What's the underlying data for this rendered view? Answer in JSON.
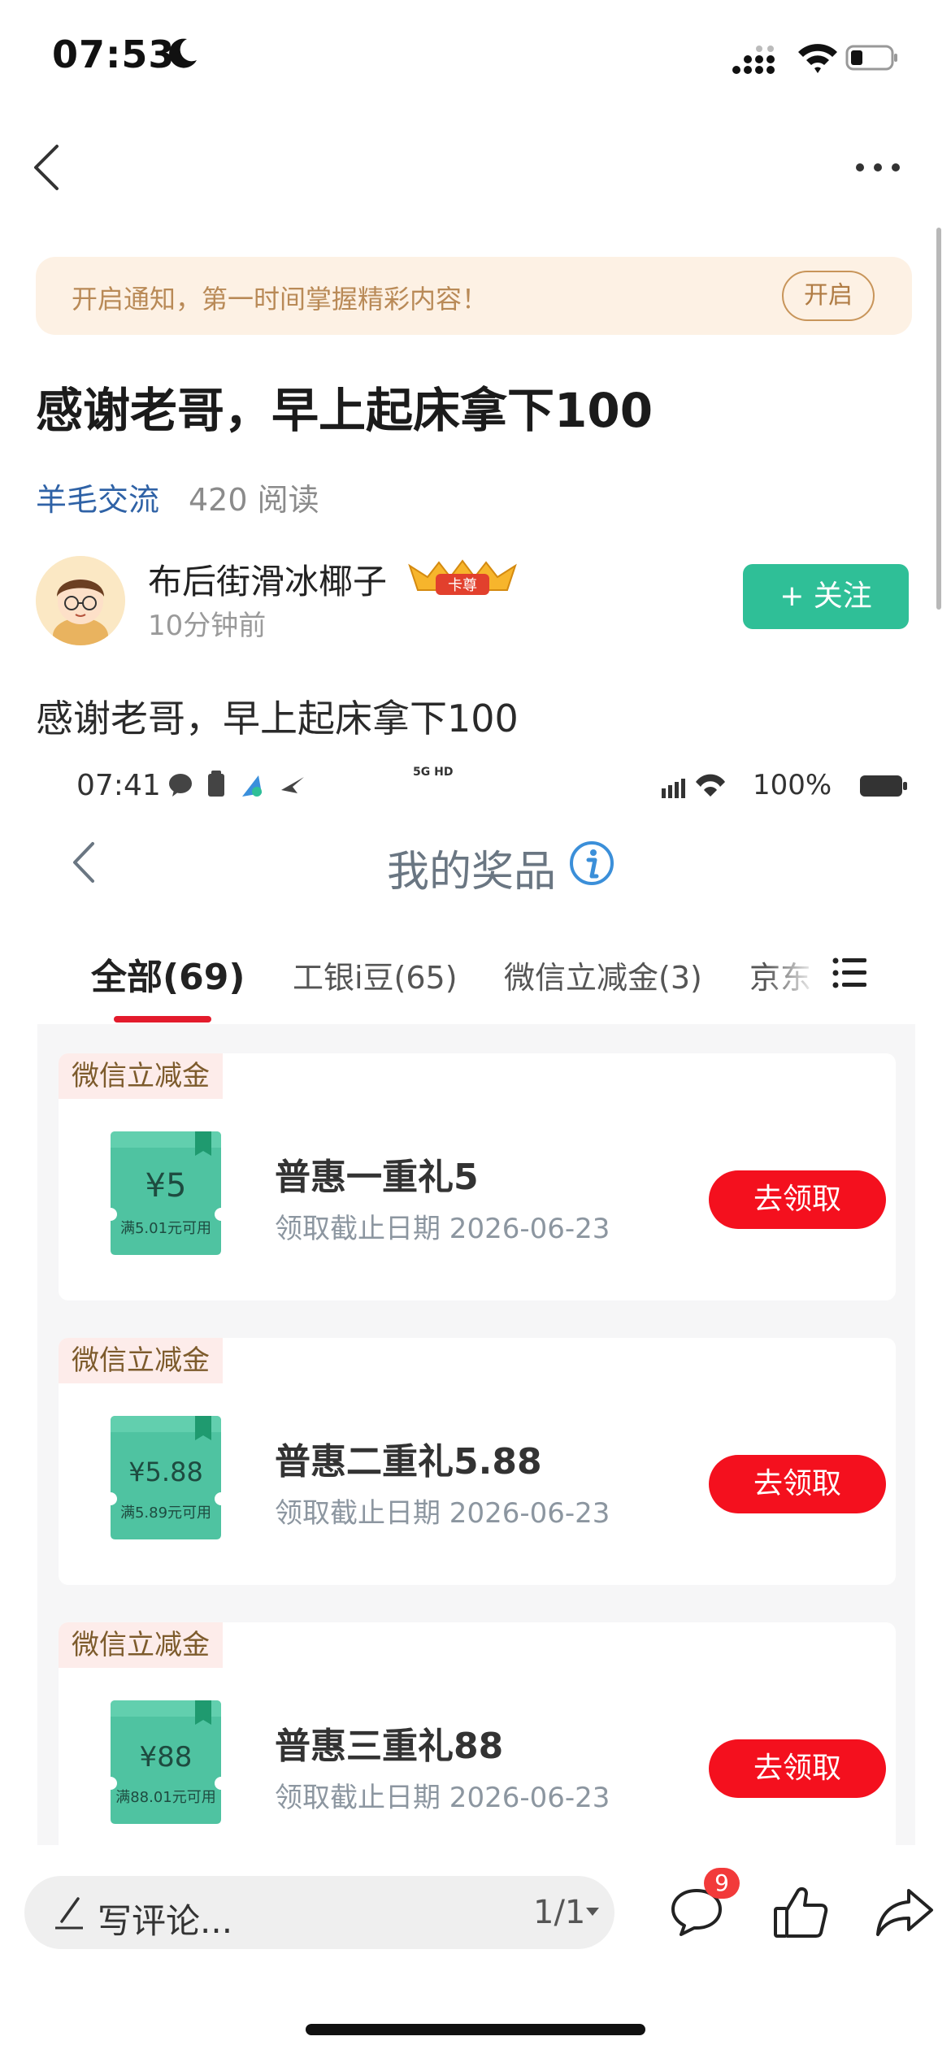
{
  "status_bar": {
    "time": "07:53"
  },
  "notify": {
    "text": "开启通知，第一时间掌握精彩内容！",
    "button": "开启"
  },
  "post": {
    "title": "感谢老哥，早上起床拿下100",
    "category": "羊毛交流",
    "reads": "420 阅读",
    "author": "布后街滑冰椰子",
    "vip_badge": "卡尊",
    "time_ago": "10分钟前",
    "follow_label": "+ 关注",
    "body": "感谢老哥，早上起床拿下100"
  },
  "screenshot": {
    "status_time": "07:41",
    "network": "5G HD",
    "battery": "100%",
    "title": "我的奖品",
    "tabs": [
      "全部(69)",
      "工银i豆(65)",
      "微信立减金(3)",
      "京东"
    ],
    "active_tab": 0,
    "cards": [
      {
        "tag": "微信立减金",
        "amount": "¥5",
        "condition": "满5.01元可用",
        "name": "普惠一重礼5",
        "date": "领取截止日期 2026-06-23",
        "button": "去领取"
      },
      {
        "tag": "微信立减金",
        "amount": "¥5.88",
        "condition": "满5.89元可用",
        "name": "普惠二重礼5.88",
        "date": "领取截止日期 2026-06-23",
        "button": "去领取"
      },
      {
        "tag": "微信立减金",
        "amount": "¥88",
        "condition": "满88.01元可用",
        "name": "普惠三重礼88",
        "date": "领取截止日期 2026-06-23",
        "button": "去领取"
      }
    ]
  },
  "bottom_bar": {
    "comment_placeholder": "写评论...",
    "page_indicator": "1/1",
    "comment_count": "9"
  },
  "colors": {
    "accent_green": "#2fbf97",
    "claim_red": "#f4101e",
    "link_blue": "#2f62a6",
    "coupon_teal": "#4fc3a1"
  },
  "icons": [
    "moon-icon",
    "signal-icon",
    "wifi-icon",
    "battery-icon",
    "back-icon",
    "more-icon",
    "info-icon",
    "menu-icon",
    "pen-icon",
    "comment-icon",
    "like-icon",
    "share-icon"
  ]
}
